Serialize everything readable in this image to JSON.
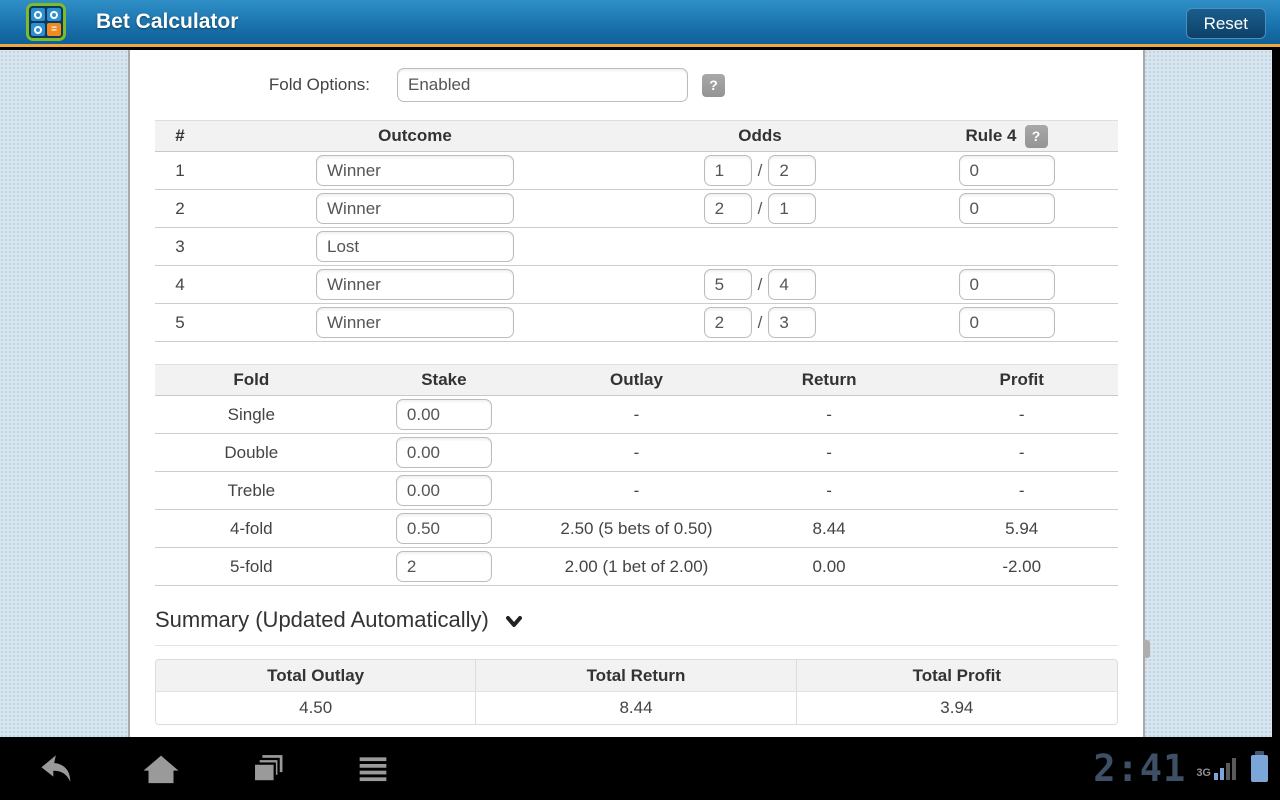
{
  "header": {
    "title": "Bet Calculator",
    "reset_label": "Reset"
  },
  "fold_options": {
    "label": "Fold Options:",
    "value": "Enabled",
    "help": "?"
  },
  "selections_table": {
    "headers": {
      "num": "#",
      "outcome": "Outcome",
      "odds": "Odds",
      "rule4": "Rule 4",
      "rule4_help": "?"
    },
    "odds_separator": "/",
    "rows": [
      {
        "num": "1",
        "outcome": "Winner",
        "odds_num": "1",
        "odds_den": "2",
        "rule4": "0"
      },
      {
        "num": "2",
        "outcome": "Winner",
        "odds_num": "2",
        "odds_den": "1",
        "rule4": "0"
      },
      {
        "num": "3",
        "outcome": "Lost"
      },
      {
        "num": "4",
        "outcome": "Winner",
        "odds_num": "5",
        "odds_den": "4",
        "rule4": "0"
      },
      {
        "num": "5",
        "outcome": "Winner",
        "odds_num": "2",
        "odds_den": "3",
        "rule4": "0"
      }
    ]
  },
  "folds_table": {
    "headers": [
      "Fold",
      "Stake",
      "Outlay",
      "Return",
      "Profit"
    ],
    "rows": [
      {
        "fold": "Single",
        "stake": "0.00",
        "outlay": "-",
        "return": "-",
        "profit": "-"
      },
      {
        "fold": "Double",
        "stake": "0.00",
        "outlay": "-",
        "return": "-",
        "profit": "-"
      },
      {
        "fold": "Treble",
        "stake": "0.00",
        "outlay": "-",
        "return": "-",
        "profit": "-"
      },
      {
        "fold": "4-fold",
        "stake": "0.50",
        "outlay": "2.50 (5 bets of 0.50)",
        "return": "8.44",
        "profit": "5.94"
      },
      {
        "fold": "5-fold",
        "stake": "2",
        "outlay": "2.00 (1 bet of 2.00)",
        "return": "0.00",
        "profit": "-2.00"
      }
    ]
  },
  "summary": {
    "heading": "Summary (Updated Automatically)",
    "headers": [
      "Total Outlay",
      "Total Return",
      "Total Profit"
    ],
    "values": [
      "4.50",
      "8.44",
      "3.94"
    ]
  },
  "system_bar": {
    "clock": "2:41",
    "network": "3G"
  },
  "colors": {
    "header_blue": "#1b74ad",
    "gold_accent": "#eda93b",
    "page_background": "#d7e5ee",
    "battery_blue": "#7ca6d8",
    "clock_color": "#3e5066"
  }
}
